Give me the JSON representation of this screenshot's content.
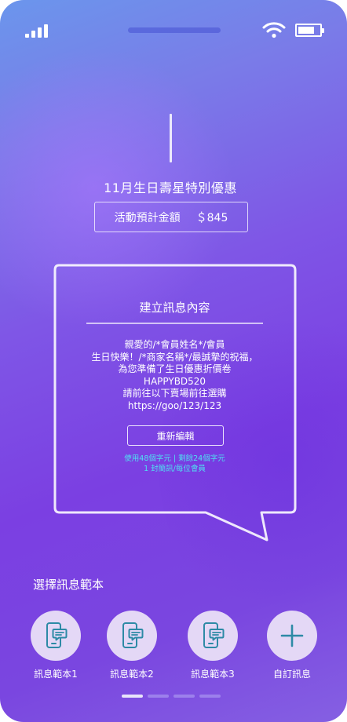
{
  "status_bar": {
    "signal_icon": "signal-bars-icon",
    "wifi_icon": "wifi-icon",
    "battery_icon": "battery-icon",
    "battery_level": 0.75
  },
  "campaign": {
    "title": "11月生日壽星特別優惠",
    "amount_label": "活動預計金額",
    "amount_value": "＄845"
  },
  "message": {
    "heading": "建立訊息內容",
    "lines": [
      "親愛的/*會員姓名*/會員",
      "生日快樂！/*商家名稱*/最誠摯的祝福，",
      "為您準備了生日優惠折價卷",
      "HAPPYBD520",
      "請前往以下賣場前往選購",
      "https://goo/123/123"
    ],
    "regenerate_label": "重新編輯",
    "stats_line1": "使用48個字元 | 剩餘24個字元",
    "stats_line2": "1 封簡訊/每位會員"
  },
  "templates": {
    "section_label": "選擇訊息範本",
    "items": [
      {
        "label": "訊息範本1",
        "icon": "phone-message-icon"
      },
      {
        "label": "訊息範本2",
        "icon": "phone-message-icon"
      },
      {
        "label": "訊息範本3",
        "icon": "phone-message-icon"
      },
      {
        "label": "自訂訊息",
        "icon": "plus-icon"
      }
    ]
  },
  "pagination": {
    "pages": 4,
    "current": 1
  },
  "colors": {
    "accent_cyan": "#4ee3f2",
    "icon_teal": "#2d8aa6",
    "circle_fill": "#e4d8f6",
    "page_dot_active": "#e8e4fa",
    "page_dot_inactive": "#9c80ec"
  }
}
